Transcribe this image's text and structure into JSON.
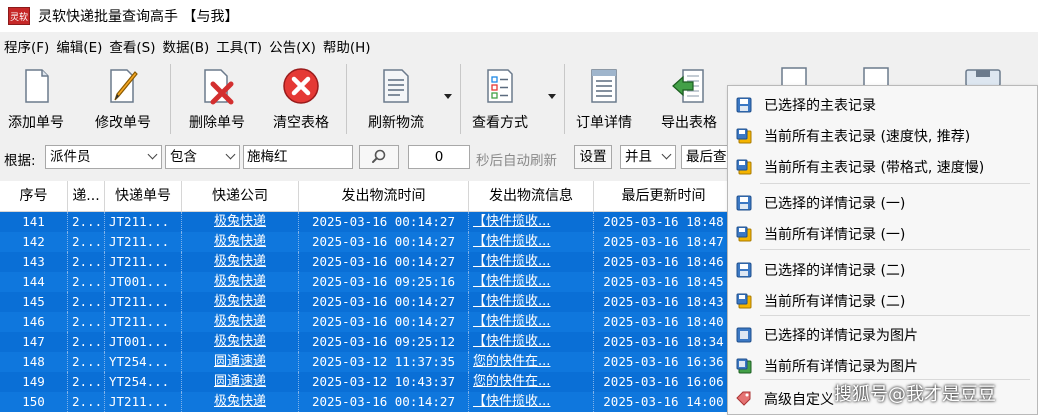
{
  "window": {
    "title": "灵软快递批量查询高手 【与我】",
    "icon_text": "灵软"
  },
  "menu": [
    "程序(F)",
    "编辑(E)",
    "查看(S)",
    "数据(B)",
    "工具(T)",
    "公告(X)",
    "帮助(H)"
  ],
  "toolbar": {
    "add": "添加单号",
    "edit": "修改单号",
    "delete": "删除单号",
    "clear": "清空表格",
    "refresh": "刷新物流",
    "view_mode": "查看方式",
    "order_detail": "订单详情",
    "export": "导出表格"
  },
  "filter": {
    "by_label": "根据:",
    "field": "派件员",
    "op": "包含",
    "value": "施梅红",
    "interval": "0",
    "auto_refresh": "秒后自动刷新",
    "settings": "设置",
    "logic": "并且",
    "last_label": "最后查"
  },
  "columns": [
    "序号",
    "递...",
    "快递单号",
    "快递公司",
    "发出物流时间",
    "发出物流信息",
    "最后更新时间"
  ],
  "rows": [
    {
      "no": "141",
      "c2": "2...",
      "tracking": "JT211...",
      "company": "极兔快递",
      "sent_time": "2025-03-16 00:14:27",
      "sent_info": "【快件揽收...",
      "last_update": "2025-03-16 18:48"
    },
    {
      "no": "142",
      "c2": "2...",
      "tracking": "JT211...",
      "company": "极兔快递",
      "sent_time": "2025-03-16 00:14:27",
      "sent_info": "【快件揽收...",
      "last_update": "2025-03-16 18:47"
    },
    {
      "no": "143",
      "c2": "2...",
      "tracking": "JT211...",
      "company": "极兔快递",
      "sent_time": "2025-03-16 00:14:27",
      "sent_info": "【快件揽收...",
      "last_update": "2025-03-16 18:46"
    },
    {
      "no": "144",
      "c2": "2...",
      "tracking": "JT001...",
      "company": "极兔快递",
      "sent_time": "2025-03-16 09:25:16",
      "sent_info": "【快件揽收...",
      "last_update": "2025-03-16 18:45"
    },
    {
      "no": "145",
      "c2": "2...",
      "tracking": "JT211...",
      "company": "极兔快递",
      "sent_time": "2025-03-16 00:14:27",
      "sent_info": "【快件揽收...",
      "last_update": "2025-03-16 18:43"
    },
    {
      "no": "146",
      "c2": "2...",
      "tracking": "JT211...",
      "company": "极兔快递",
      "sent_time": "2025-03-16 00:14:27",
      "sent_info": "【快件揽收...",
      "last_update": "2025-03-16 18:40"
    },
    {
      "no": "147",
      "c2": "2...",
      "tracking": "JT001...",
      "company": "极兔快递",
      "sent_time": "2025-03-16 09:25:12",
      "sent_info": "【快件揽收...",
      "last_update": "2025-03-16 18:34"
    },
    {
      "no": "148",
      "c2": "2...",
      "tracking": "YT254...",
      "company": "圆通速递",
      "sent_time": "2025-03-12 11:37:35",
      "sent_info": "您的快件在...",
      "last_update": "2025-03-16 16:36"
    },
    {
      "no": "149",
      "c2": "2...",
      "tracking": "YT254...",
      "company": "圆通速递",
      "sent_time": "2025-03-12 10:43:37",
      "sent_info": "您的快件在...",
      "last_update": "2025-03-16 16:06"
    },
    {
      "no": "150",
      "c2": "2...",
      "tracking": "JT211...",
      "company": "极兔快递",
      "sent_time": "2025-03-16 00:14:27",
      "sent_info": "【快件揽收...",
      "last_update": "2025-03-16 14:00"
    }
  ],
  "context_menu": [
    {
      "label": "已选择的主表记录",
      "icon": "save-icon"
    },
    {
      "label": "当前所有主表记录 (速度快, 推荐)",
      "icon": "save-all-icon"
    },
    {
      "label": "当前所有主表记录 (带格式, 速度慢)",
      "icon": "save-all-icon"
    },
    {
      "label": "已选择的详情记录 (一)",
      "icon": "save-icon"
    },
    {
      "label": "当前所有详情记录 (一)",
      "icon": "save-all-icon"
    },
    {
      "label": "已选择的详情记录 (二)",
      "icon": "save-icon"
    },
    {
      "label": "当前所有详情记录 (二)",
      "icon": "save-all-icon"
    },
    {
      "label": "已选择的详情记录为图片",
      "icon": "image-icon"
    },
    {
      "label": "当前所有详情记录为图片",
      "icon": "image-all-icon"
    },
    {
      "label": "高级自定义",
      "icon": "tag-icon"
    }
  ],
  "watermark": "搜狐号@我才是豆豆",
  "colors": {
    "selection": "#0a6fd6",
    "menu_bg": "#f7f7f7",
    "delete_red": "#d32f2f"
  }
}
